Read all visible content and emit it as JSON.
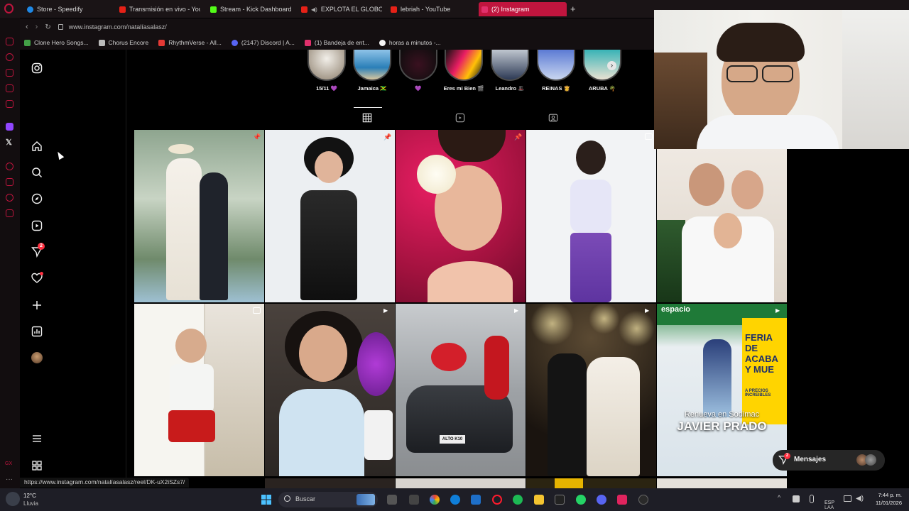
{
  "browser": {
    "tabs": [
      {
        "label": "Store - Speedify",
        "color": "#1e88e5"
      },
      {
        "label": "Transmisión en vivo - You",
        "color": "#e62117"
      },
      {
        "label": "Stream - Kick Dashboard",
        "color": "#53fc18"
      },
      {
        "label": "EXPLOTA EL GLOBO C",
        "color": "#e62117"
      },
      {
        "label": "lebriah - YouTube",
        "color": "#e62117"
      },
      {
        "label": "(2) Instagram",
        "color": "#e1306c"
      }
    ],
    "url": "www.instagram.com/natalíasalasz/",
    "bookmarks": [
      {
        "label": "Clone Hero Songs...",
        "color": "#43a047"
      },
      {
        "label": "Chorus Encore",
        "color": "#d0d0d0"
      },
      {
        "label": "RhythmVerse - All...",
        "color": "#e53935"
      },
      {
        "label": "(2147) Discord | A...",
        "color": "#5865f2"
      },
      {
        "label": "(1) Bandeja de ent...",
        "color": "#e1306c"
      },
      {
        "label": "horas a minutos -...",
        "color": "#f5f5f5"
      }
    ]
  },
  "instagram": {
    "highlights": [
      {
        "label": "15/11 💜"
      },
      {
        "label": "Jamaica 🇯🇲"
      },
      {
        "label": "💜"
      },
      {
        "label": "Eres mi Bien 🎬"
      },
      {
        "label": "Leandro 🎩"
      },
      {
        "label": "REINAS 👸"
      },
      {
        "label": "ARUBA 🌴"
      }
    ],
    "notif_badge": "2",
    "posts_overlay_text": {
      "line1": "Renueva en Sodimac",
      "line2": "JAVIER PRADO",
      "banner": "FERIA DE ACABA Y MUE",
      "banner_sub": "A PRECIOS INCREIBLES",
      "top_banner": "espacio",
      "plate": "ALTO K10"
    },
    "messages": {
      "label": "Mensajes",
      "badge": "2"
    }
  },
  "status_url": "https://www.instagram.com/natalíasalasz/reel/DK-uX2iSZs7/",
  "taskbar": {
    "weather_temp": "12°C",
    "weather_desc": "Lluvia",
    "search_placeholder": "Buscar",
    "lang_line1": "ESP",
    "lang_line2": "LAA",
    "time": "7:44 p. m.",
    "date": "11/01/2026"
  }
}
